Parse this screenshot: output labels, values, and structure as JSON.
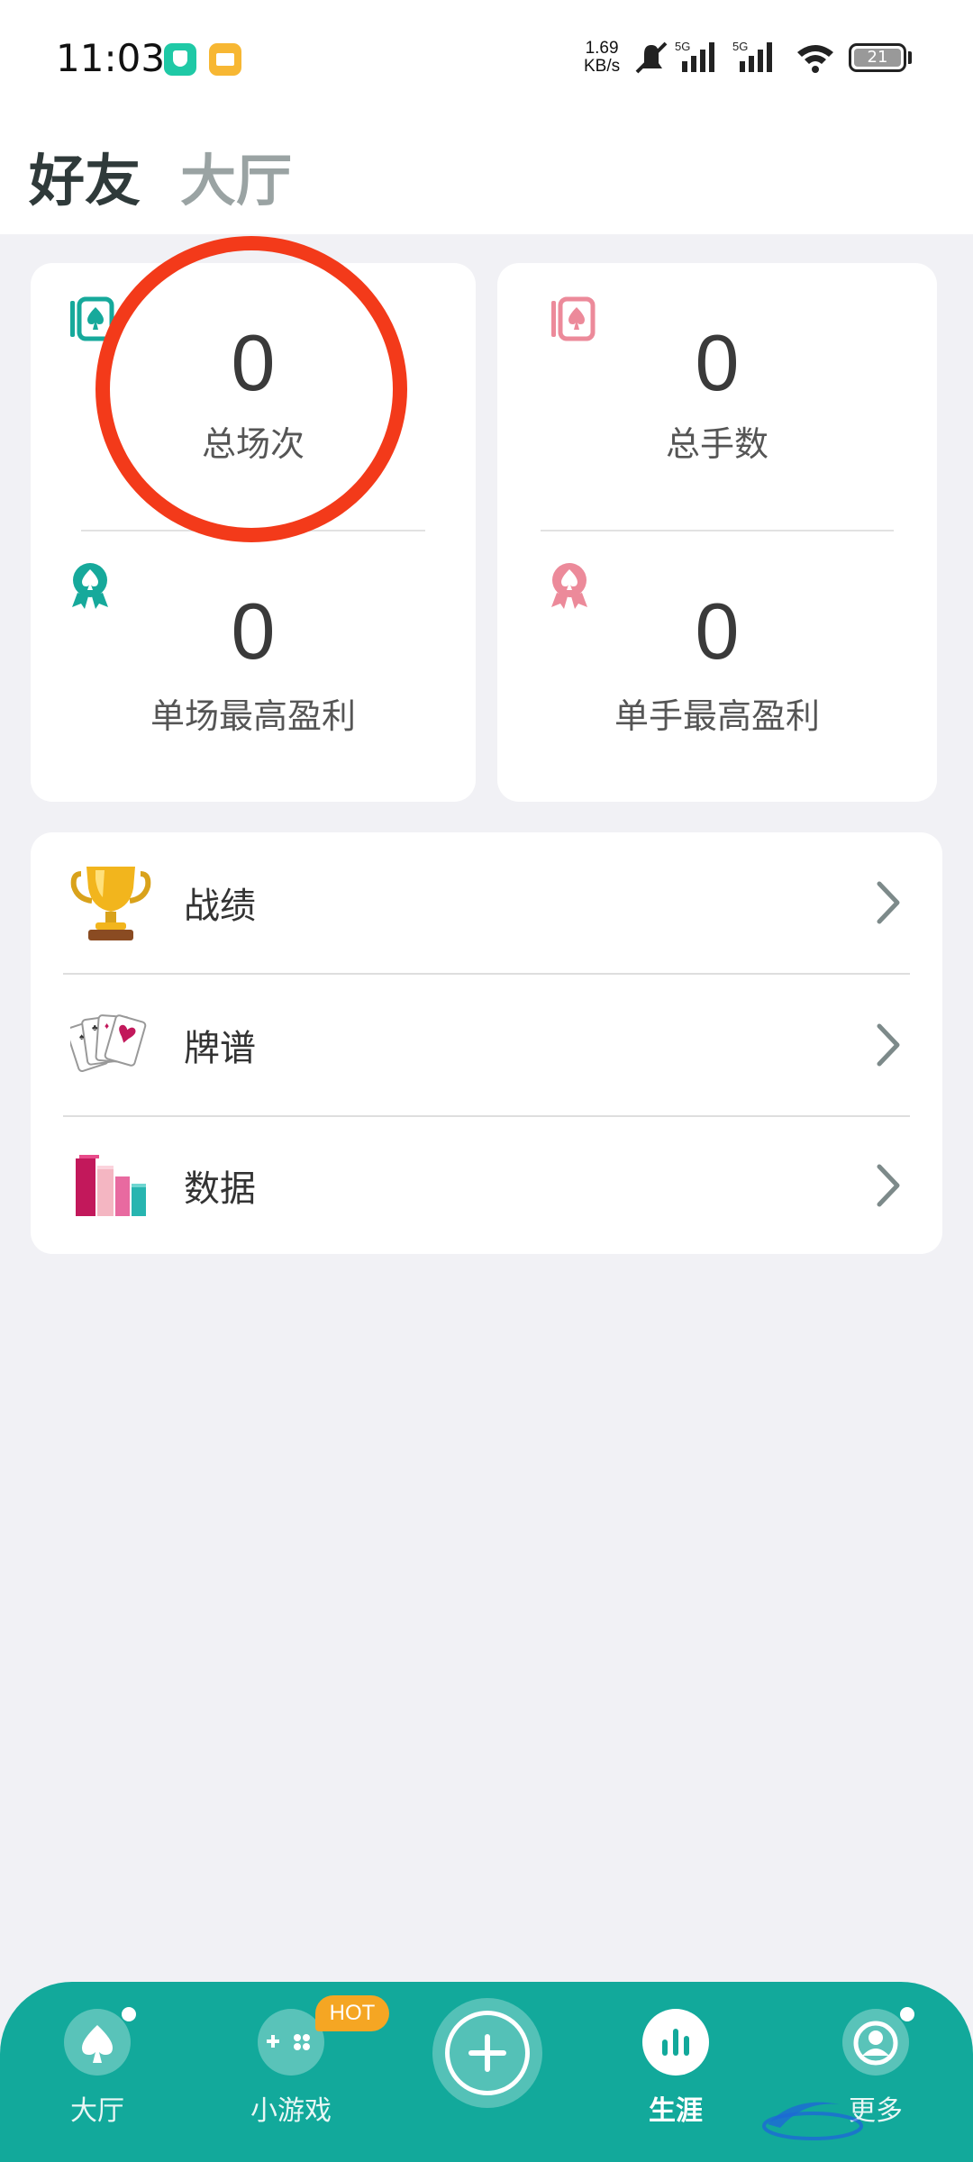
{
  "status_bar": {
    "time": "11:03",
    "speed_value": "1.69",
    "speed_unit": "KB/s",
    "network_1": "5G",
    "network_2": "5G",
    "battery": "21"
  },
  "header": {
    "tabs": [
      {
        "label": "好友",
        "active": true
      },
      {
        "label": "大厅",
        "active": false
      }
    ]
  },
  "stats": {
    "total_sessions": {
      "value": "0",
      "label": "总场次"
    },
    "total_hands": {
      "value": "0",
      "label": "总手数"
    },
    "max_session_profit": {
      "value": "0",
      "label": "单场最高盈利"
    },
    "max_hand_profit": {
      "value": "0",
      "label": "单手最高盈利"
    }
  },
  "menu": {
    "items": [
      {
        "label": "战绩",
        "icon": "trophy-icon"
      },
      {
        "label": "牌谱",
        "icon": "playing-cards-icon"
      },
      {
        "label": "数据",
        "icon": "bar-chart-icon"
      }
    ]
  },
  "bottom_nav": {
    "items": [
      {
        "label": "大厅",
        "icon": "spade-icon"
      },
      {
        "label": "小游戏",
        "icon": "gamepad-icon",
        "badge": "HOT"
      },
      {
        "label": "",
        "icon": "add-icon"
      },
      {
        "label": "生涯",
        "icon": "stats-icon",
        "active": true
      },
      {
        "label": "更多",
        "icon": "profile-icon"
      }
    ]
  },
  "colors": {
    "teal": "#12a99b",
    "pink": "#ec8a9a",
    "annotation_red": "#f33a1a",
    "hot_badge": "#f5a623"
  }
}
